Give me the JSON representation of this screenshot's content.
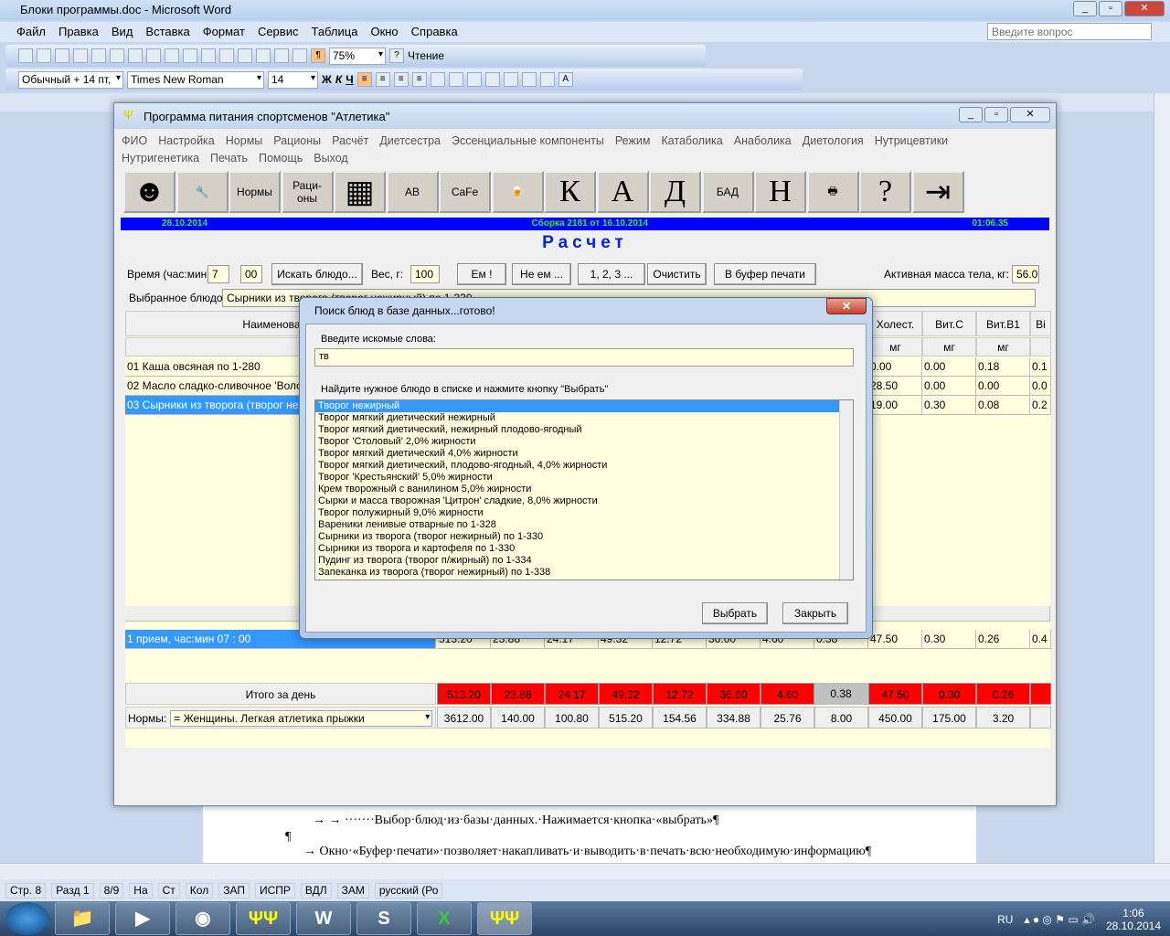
{
  "word": {
    "title": "Блоки программы.doc - Microsoft Word",
    "menu": [
      "Файл",
      "Правка",
      "Вид",
      "Вставка",
      "Формат",
      "Сервис",
      "Таблица",
      "Окно",
      "Справка"
    ],
    "ask_placeholder": "Введите вопрос",
    "zoom": "75%",
    "reading": "Чтение",
    "style": "Обычный + 14 пт,",
    "font": "Times New Roman",
    "size": "14",
    "fmt": [
      "Ж",
      "К",
      "Ч"
    ],
    "doc_lines": [
      "→ → ·······Выбор·блюд·из·базы·данных.·Нажимается·кнопка·«выбрать»¶",
      "¶",
      "→ Окно·«Буфер·печати»·позволяет·накапливать·и·выводить·в·печать·всю·необходимую·информацию¶"
    ],
    "status": [
      "Стр. 8",
      "Разд 1",
      "8/9",
      "На",
      "Ст",
      "Кол",
      "ЗАП",
      "ИСПР",
      "ВДЛ",
      "ЗАМ",
      "русский (Ро"
    ]
  },
  "taskbar": {
    "lang": "RU",
    "time": "1:06",
    "date": "28.10.2014"
  },
  "app": {
    "title": "Программа питания спортсменов \"Атлетика\"",
    "menu": [
      "ФИО",
      "Настройка",
      "Нормы",
      "Рационы",
      "Расчёт",
      "Диетсестра",
      "Эссенциальные компоненты",
      "Режим",
      "Катаболика",
      "Анаболика",
      "Диетология",
      "Нутрицевтики",
      "Нутригенетика",
      "Печать",
      "Помощь",
      "Выход"
    ],
    "tools": [
      {
        "n": "person",
        "t": "☻"
      },
      {
        "n": "settings",
        "t": "🔧"
      },
      {
        "n": "norms",
        "t": "Нормы"
      },
      {
        "n": "rations",
        "t": "Раци-оны"
      },
      {
        "n": "calculator",
        "t": "▦"
      },
      {
        "n": "vitamins",
        "t": "AB"
      },
      {
        "n": "minerals",
        "t": "CaFe"
      },
      {
        "n": "drink",
        "t": "🍺"
      },
      {
        "n": "k",
        "t": "К"
      },
      {
        "n": "a",
        "t": "А"
      },
      {
        "n": "d",
        "t": "Д"
      },
      {
        "n": "bad",
        "t": "БАД"
      },
      {
        "n": "n",
        "t": "Н"
      },
      {
        "n": "print",
        "t": "🖶"
      },
      {
        "n": "help",
        "t": "?"
      },
      {
        "n": "exit",
        "t": "⇥"
      }
    ],
    "date": "28.10.2014",
    "build": "Сборка 2181 от 16.10.2014",
    "clock": "01:06.35",
    "heading": "Расчет",
    "time_label": "Время (час:мин)",
    "hour": "7",
    "minute": "00",
    "search_btn": "Искать блюдо...",
    "weight_label": "Вес, г:",
    "weight": "100",
    "buttons": [
      "Ем !",
      "Не ем ...",
      "1, 2, 3 ...",
      "Очистить",
      "В буфер печати"
    ],
    "mass_label": "Активная масса тела, кг:",
    "mass": "56.0",
    "selected_label": "Выбранное блюдо:",
    "selected": "Сырники из творога (творог нежирный) по 1-330",
    "col_name": "Наименование",
    "cols": [
      "Холест.",
      "Вит.C",
      "Вит.B1",
      "Ві"
    ],
    "units": [
      "мг",
      "мг",
      "мг",
      ""
    ],
    "rows": [
      {
        "name": "01 Каша овсяная по 1-280",
        "v": [
          "0.00",
          "0.00",
          "0.18",
          "0.1"
        ]
      },
      {
        "name": "02 Масло сладко-сливочное 'Вологодское'",
        "v": [
          "28.50",
          "0.00",
          "0.00",
          "0.0"
        ]
      },
      {
        "name": "03 Сырники из творога (творог нежирный)",
        "v": [
          "19.00",
          "0.30",
          "0.08",
          "0.2"
        ]
      }
    ],
    "meal": {
      "name": "1 прием, час:мин  07 : 00",
      "v": [
        "513.20",
        "23.88",
        "24.17",
        "49.32",
        "12.72",
        "36.60",
        "4.60",
        "0.38",
        "47.50",
        "0.30",
        "0.26",
        "0.4"
      ]
    },
    "total_label": "Итого за день",
    "totals": [
      "513.20",
      "23.88",
      "24.17",
      "49.32",
      "12.72",
      "36.60",
      "4.60",
      "0.38",
      "47.50",
      "0.30",
      "0.26",
      ""
    ],
    "norms_label": "Нормы:",
    "norms_value": "= Женщины. Легкая атлетика прыжки",
    "norms": [
      "3612.00",
      "140.00",
      "100.80",
      "515.20",
      "154.56",
      "334.88",
      "25.76",
      "8.00",
      "450.00",
      "175.00",
      "3.20",
      ""
    ]
  },
  "dialog": {
    "title": "Поиск блюд в базе данных...готово!",
    "prompt": "Введите искомые слова:",
    "query": "тв",
    "hint": "Найдите нужное блюдо в списке и нажмите кнопку \"Выбрать\"",
    "items": [
      "Творог нежирный",
      "Творог мягкий диетический нежирный",
      "Творог мягкий диетический, нежирный плодово-ягодный",
      "Творог 'Столовый' 2,0% жирности",
      "Творог мягкий диетический 4,0% жирности",
      "Творог мягкий диетический, плодово-ягодный, 4,0% жирности",
      "Творог 'Крестьянский' 5,0% жирности",
      "Крем творожный с ванилином 5,0% жирности",
      "Сырки и масса творожная 'Цитрон' сладкие, 8,0% жирности",
      "Творог полужирный 9,0% жирности",
      "Вареники ленивые отварные по 1-328",
      "Сырники из творога (творог нежирный) по 1-330",
      "Сырники из творога и картофеля по 1-330",
      "Пудинг из творога (творог п/жирный) по 1-334",
      "Запеканка из творога (творог нежирный) по 1-338"
    ],
    "select_btn": "Выбрать",
    "close_btn": "Закрыть"
  }
}
